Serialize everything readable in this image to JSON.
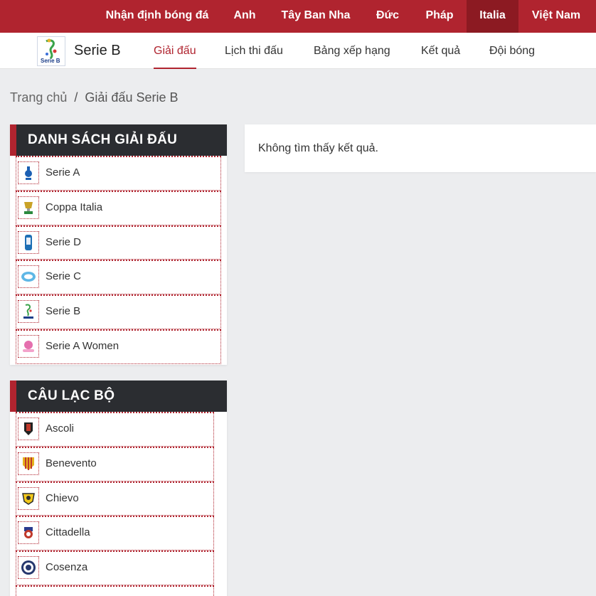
{
  "topnav": {
    "items": [
      {
        "label": "Nhận định bóng đá"
      },
      {
        "label": "Anh"
      },
      {
        "label": "Tây Ban Nha"
      },
      {
        "label": "Đức"
      },
      {
        "label": "Pháp"
      },
      {
        "label": "Italia",
        "active": true
      },
      {
        "label": "Việt Nam"
      }
    ]
  },
  "subnav": {
    "logo_text": "Serie B",
    "brand": "Serie B",
    "tabs": [
      {
        "label": "Giải đấu",
        "active": true
      },
      {
        "label": "Lịch thi đấu"
      },
      {
        "label": "Bảng xếp hạng"
      },
      {
        "label": "Kết quả"
      },
      {
        "label": "Đội bóng"
      }
    ]
  },
  "breadcrumb": {
    "home": "Trang chủ",
    "separator": "/",
    "current": "Giải đấu Serie B"
  },
  "leagues": {
    "title": "DANH SÁCH GIẢI ĐẤU",
    "items": [
      {
        "label": "Serie A",
        "icon": "serie-a-logo-icon"
      },
      {
        "label": "Coppa Italia",
        "icon": "coppa-italia-logo-icon"
      },
      {
        "label": "Serie D",
        "icon": "serie-d-logo-icon"
      },
      {
        "label": "Serie C",
        "icon": "serie-c-logo-icon"
      },
      {
        "label": "Serie B",
        "icon": "serie-b-logo-icon"
      },
      {
        "label": "Serie A Women",
        "icon": "serie-a-women-logo-icon"
      }
    ]
  },
  "clubs": {
    "title": "CÂU LẠC BỘ",
    "items": [
      {
        "label": "Ascoli",
        "icon": "ascoli-crest-icon"
      },
      {
        "label": "Benevento",
        "icon": "benevento-crest-icon"
      },
      {
        "label": "Chievo",
        "icon": "chievo-crest-icon"
      },
      {
        "label": "Cittadella",
        "icon": "cittadella-crest-icon"
      },
      {
        "label": "Cosenza",
        "icon": "cosenza-crest-icon"
      }
    ]
  },
  "result": {
    "message": "Không tìm thấy kết quả."
  },
  "colors": {
    "accent": "#b0242f",
    "accent_dark": "#8c1a22",
    "panel_header": "#2b2d31",
    "background": "#ecedef"
  }
}
